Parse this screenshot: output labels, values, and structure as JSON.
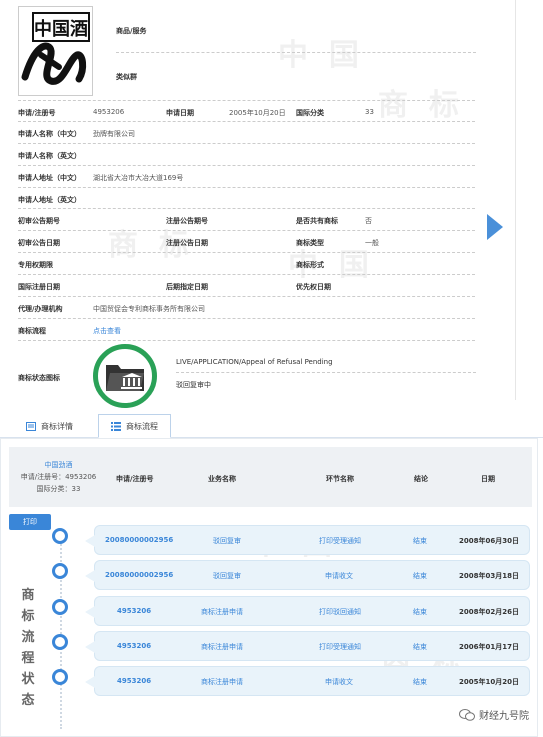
{
  "detail": {
    "logo_text": "中国酒",
    "goods_label": "商品/服务",
    "similar_group_label": "类似群",
    "rows": [
      {
        "label": "申请/注册号",
        "value": "4953206",
        "label2": "申请日期",
        "value2": "2005年10月20日",
        "label3": "国际分类",
        "value3": "33"
      },
      {
        "label": "申请人名称（中文）",
        "value": "劲牌有限公司"
      },
      {
        "label": "申请人名称（英文）",
        "value": ""
      },
      {
        "label": "申请人地址（中文）",
        "value": "湖北省大冶市大冶大道169号"
      },
      {
        "label": "申请人地址（英文）",
        "value": ""
      },
      {
        "label": "初审公告期号",
        "value": "",
        "label2": "注册公告期号",
        "value2": "",
        "label3": "是否共有商标",
        "value3": "否"
      },
      {
        "label": "初审公告日期",
        "value": "",
        "label2": "注册公告日期",
        "value2": "",
        "label3": "商标类型",
        "value3": "一般"
      },
      {
        "label": "专用权期限",
        "value": "",
        "label3": "商标形式",
        "value3": ""
      },
      {
        "label": "国际注册日期",
        "value": "",
        "label2": "后期指定日期",
        "value2": "",
        "label3": "优先权日期",
        "value3": ""
      },
      {
        "label": "代理/办理机构",
        "value": "中国贸促会专利商标事务所有限公司"
      },
      {
        "label": "商标流程",
        "value": "点击查看"
      }
    ],
    "status_label": "商标状态图标",
    "status_en": "LIVE/APPLICATION/Appeal of Refusal Pending",
    "status_cn": "驳回复审中",
    "watermark": "中国商标"
  },
  "tabs": [
    {
      "label": "商标详情",
      "icon": "document-icon"
    },
    {
      "label": "商标流程",
      "icon": "list-icon"
    }
  ],
  "flow": {
    "info": {
      "name": "中国劲酒",
      "reg": "申请/注册号：4953206",
      "cls": "国际分类：33"
    },
    "headers": [
      "申请/注册号",
      "业务名称",
      "环节名称",
      "结论",
      "日期"
    ],
    "print_label": "打印",
    "vertical_title": [
      "商",
      "标",
      "流",
      "程",
      "状",
      "态"
    ],
    "rows": [
      {
        "num": "20080000002956",
        "biz": "驳回复审",
        "step": "打印受理通知",
        "result": "结束",
        "date": "2008年06月30日"
      },
      {
        "num": "20080000002956",
        "biz": "驳回复审",
        "step": "申请收文",
        "result": "结束",
        "date": "2008年03月18日"
      },
      {
        "num": "4953206",
        "biz": "商标注册申请",
        "step": "打印驳回通知",
        "result": "结束",
        "date": "2008年02月26日"
      },
      {
        "num": "4953206",
        "biz": "商标注册申请",
        "step": "打印受理通知",
        "result": "结束",
        "date": "2006年01月17日"
      },
      {
        "num": "4953206",
        "biz": "商标注册申请",
        "step": "申请收文",
        "result": "结束",
        "date": "2005年10月20日"
      }
    ],
    "wechat": "财经九号院"
  },
  "colors": {
    "accent": "#3a86d8",
    "status_green": "#2aa157",
    "arrow": "#4a90d9"
  }
}
